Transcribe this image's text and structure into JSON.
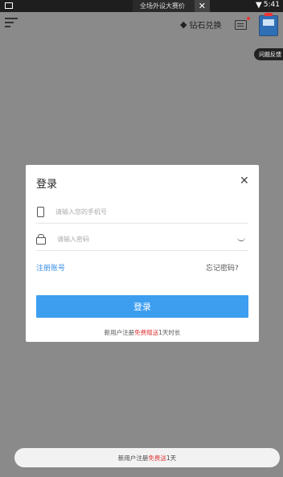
{
  "statusbar": {
    "time": "5:41",
    "wifi_icon": "wifi-icon"
  },
  "ad_banner": {
    "text": "全场外设大赛价",
    "close_glyph": "✕"
  },
  "topbar": {
    "menu_icon": "menu-icon",
    "diamond_label": "钻石兑换",
    "diamond_glyph": "◆",
    "message_icon": "message-icon",
    "feedback_label": "问题反馈"
  },
  "modal": {
    "title": "登录",
    "close_glyph": "✕",
    "phone_placeholder": "请输入您的手机号",
    "password_placeholder": "请输入密码",
    "register_link": "注册账号",
    "forgot_link": "忘记密码?",
    "login_button": "登录",
    "note_prefix": "新用户注册",
    "note_highlight": "免费赠送",
    "note_suffix": "1天时长"
  },
  "bottom_bar": {
    "prefix": "新用户注册",
    "highlight": "免费送",
    "suffix": "1天"
  },
  "colors": {
    "overlay": "#8a8a8a",
    "accent": "#3d9ef0",
    "highlight": "#e03a3a"
  }
}
